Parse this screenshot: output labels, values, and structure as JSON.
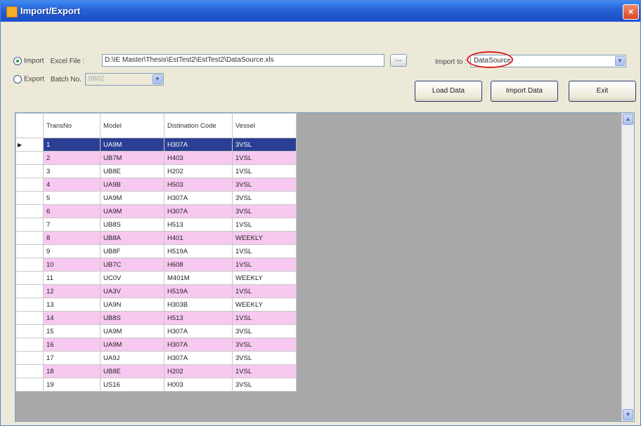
{
  "window": {
    "title": "Import/Export",
    "close_glyph": "×"
  },
  "import_row": {
    "option_label": "Import",
    "file_label": "Excel File :",
    "file_path": "D:\\IE Master\\Thesis\\EstTest2\\EstTest2\\DataSource.xls",
    "browse_label": "..."
  },
  "export_row": {
    "option_label": "Export",
    "batch_label": "Batch No.",
    "batch_value": "0802"
  },
  "import_to": {
    "label": "Import to :",
    "value": "DataSource"
  },
  "buttons": {
    "load": "Load Data",
    "import": "Import Data",
    "exit": "Exit"
  },
  "grid": {
    "columns": [
      "TransNo",
      "Model",
      "Distination Code",
      "Vessel"
    ],
    "rows": [
      {
        "transno": "1",
        "model": "UA9M",
        "dest": "H307A",
        "vessel": "3VSL",
        "style": "selected"
      },
      {
        "transno": "2",
        "model": "UB7M",
        "dest": "H403",
        "vessel": "1VSL",
        "style": "pink"
      },
      {
        "transno": "3",
        "model": "UB8E",
        "dest": "H202",
        "vessel": "1VSL",
        "style": "white"
      },
      {
        "transno": "4",
        "model": "UA9B",
        "dest": "H503",
        "vessel": "3VSL",
        "style": "pink"
      },
      {
        "transno": "5",
        "model": "UA9M",
        "dest": "H307A",
        "vessel": "3VSL",
        "style": "white"
      },
      {
        "transno": "6",
        "model": "UA9M",
        "dest": "H307A",
        "vessel": "3VSL",
        "style": "pink"
      },
      {
        "transno": "7",
        "model": "UB8S",
        "dest": "H513",
        "vessel": "1VSL",
        "style": "white"
      },
      {
        "transno": "8",
        "model": "UB8A",
        "dest": "H401",
        "vessel": "WEEKLY",
        "style": "pink"
      },
      {
        "transno": "9",
        "model": "UB8F",
        "dest": "H519A",
        "vessel": "1VSL",
        "style": "white"
      },
      {
        "transno": "10",
        "model": "UB7C",
        "dest": "H608",
        "vessel": "1VSL",
        "style": "pink"
      },
      {
        "transno": "11",
        "model": "UC0V",
        "dest": "M401M",
        "vessel": "WEEKLY",
        "style": "white"
      },
      {
        "transno": "12",
        "model": "UA3V",
        "dest": "H519A",
        "vessel": "1VSL",
        "style": "pink"
      },
      {
        "transno": "13",
        "model": "UA9N",
        "dest": "H303B",
        "vessel": "WEEKLY",
        "style": "white"
      },
      {
        "transno": "14",
        "model": "UB8S",
        "dest": "H513",
        "vessel": "1VSL",
        "style": "pink"
      },
      {
        "transno": "15",
        "model": "UA9M",
        "dest": "H307A",
        "vessel": "3VSL",
        "style": "white"
      },
      {
        "transno": "16",
        "model": "UA9M",
        "dest": "H307A",
        "vessel": "3VSL",
        "style": "pink"
      },
      {
        "transno": "17",
        "model": "UA9J",
        "dest": "H307A",
        "vessel": "3VSL",
        "style": "white"
      },
      {
        "transno": "18",
        "model": "UB8E",
        "dest": "H202",
        "vessel": "1VSL",
        "style": "pink"
      },
      {
        "transno": "19",
        "model": "US16",
        "dest": "H003",
        "vessel": "3VSL",
        "style": "white"
      }
    ]
  },
  "colors": {
    "selected_row": "#2a3f93",
    "pink_row": "#f7c9f0",
    "grid_background": "#a9a9a9",
    "title_bar": "#2a64d8"
  },
  "icons": {
    "app": "app-icon",
    "close": "close-icon",
    "combo_arrow": "chevron-down-icon",
    "scroll_up": "arrow-up-icon",
    "scroll_down": "arrow-down-icon",
    "row_pointer": "current-row-arrow-icon"
  }
}
